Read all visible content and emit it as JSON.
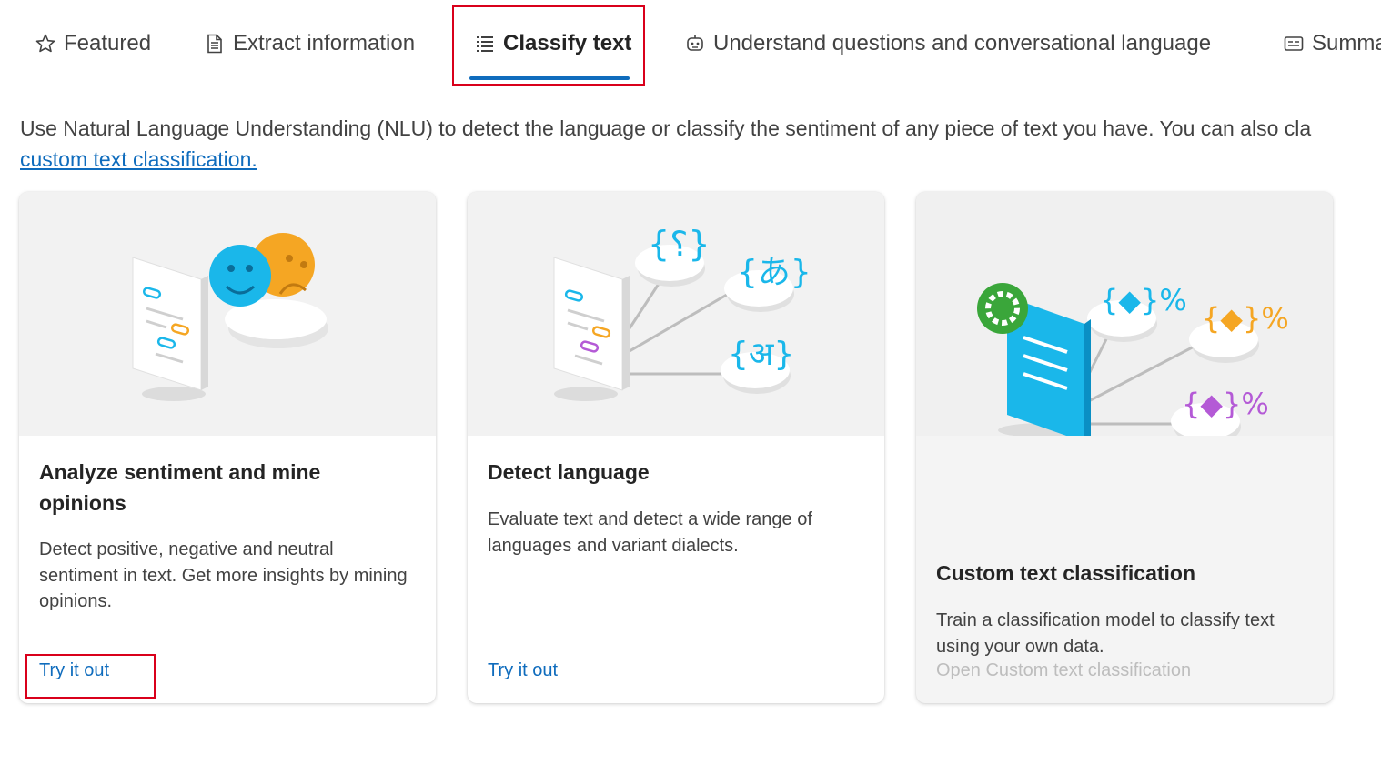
{
  "tabs": [
    {
      "label": "Featured",
      "icon": "star-icon"
    },
    {
      "label": "Extract information",
      "icon": "document-icon"
    },
    {
      "label": "Classify text",
      "icon": "list-icon",
      "active": true
    },
    {
      "label": "Understand questions and conversational language",
      "icon": "chat-bot-icon"
    },
    {
      "label": "Summa",
      "icon": "summary-icon"
    }
  ],
  "intro": {
    "text": "Use Natural Language Understanding (NLU) to detect the language or classify the sentiment of any piece of text you have. You can also cla",
    "link": "custom text classification."
  },
  "cards": [
    {
      "title": "Analyze sentiment and mine opinions",
      "description": "Detect positive, negative and neutral sentiment in text. Get more insights by mining opinions.",
      "link": "Try it out"
    },
    {
      "title": "Detect language",
      "description": "Evaluate text and detect a wide range of languages and variant dialects.",
      "link": "Try it out"
    },
    {
      "title": "Custom text classification",
      "description": "Train a classification model to classify text using your own data.",
      "link": "Open Custom text classification"
    }
  ],
  "colors": {
    "accent": "#0f6cbd",
    "highlight": "#d9001b",
    "cyan": "#1ab7ea",
    "orange": "#f5a623",
    "purple": "#b45ad6",
    "green": "#3aa63a"
  }
}
